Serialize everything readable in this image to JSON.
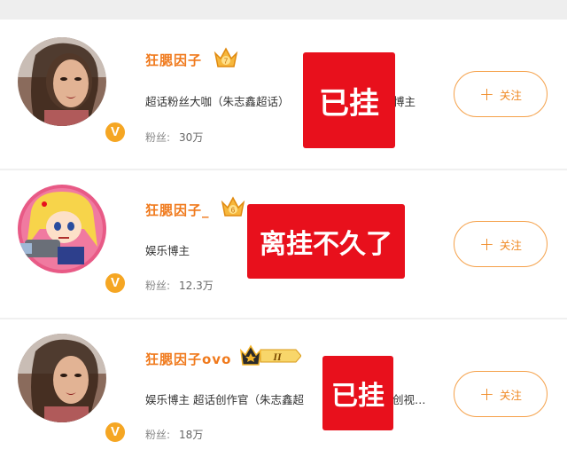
{
  "users": [
    {
      "name": "狂腮因子",
      "description": "超话粉丝大咖（朱志鑫超话）",
      "description_tail": "博主",
      "fans_label": "粉丝:",
      "fans_count": "30万",
      "follow_label": "关注",
      "follow_icon": "plus-icon",
      "badge_letter": "V",
      "crown_level": "7",
      "stamp_text": "已挂"
    },
    {
      "name": "狂腮因子_",
      "description": "娱乐博主",
      "fans_label": "粉丝:",
      "fans_count": "12.3万",
      "follow_label": "关注",
      "follow_icon": "plus-icon",
      "badge_letter": "V",
      "crown_level": "6",
      "stamp_text": "离挂不久了"
    },
    {
      "name": "狂腮因子ovo",
      "description": "娱乐博主  超话创作官（朱志鑫超",
      "description_tail": "创视…",
      "fans_label": "粉丝:",
      "fans_count": "18万",
      "follow_label": "关注",
      "follow_icon": "plus-icon",
      "badge_letter": "V",
      "crown_level": "II",
      "stamp_text": "已挂"
    }
  ],
  "colors": {
    "name": "#f07a1d",
    "stamp": "#e8101c",
    "badge": "#f5a623",
    "follow_border": "#f5a14a"
  }
}
